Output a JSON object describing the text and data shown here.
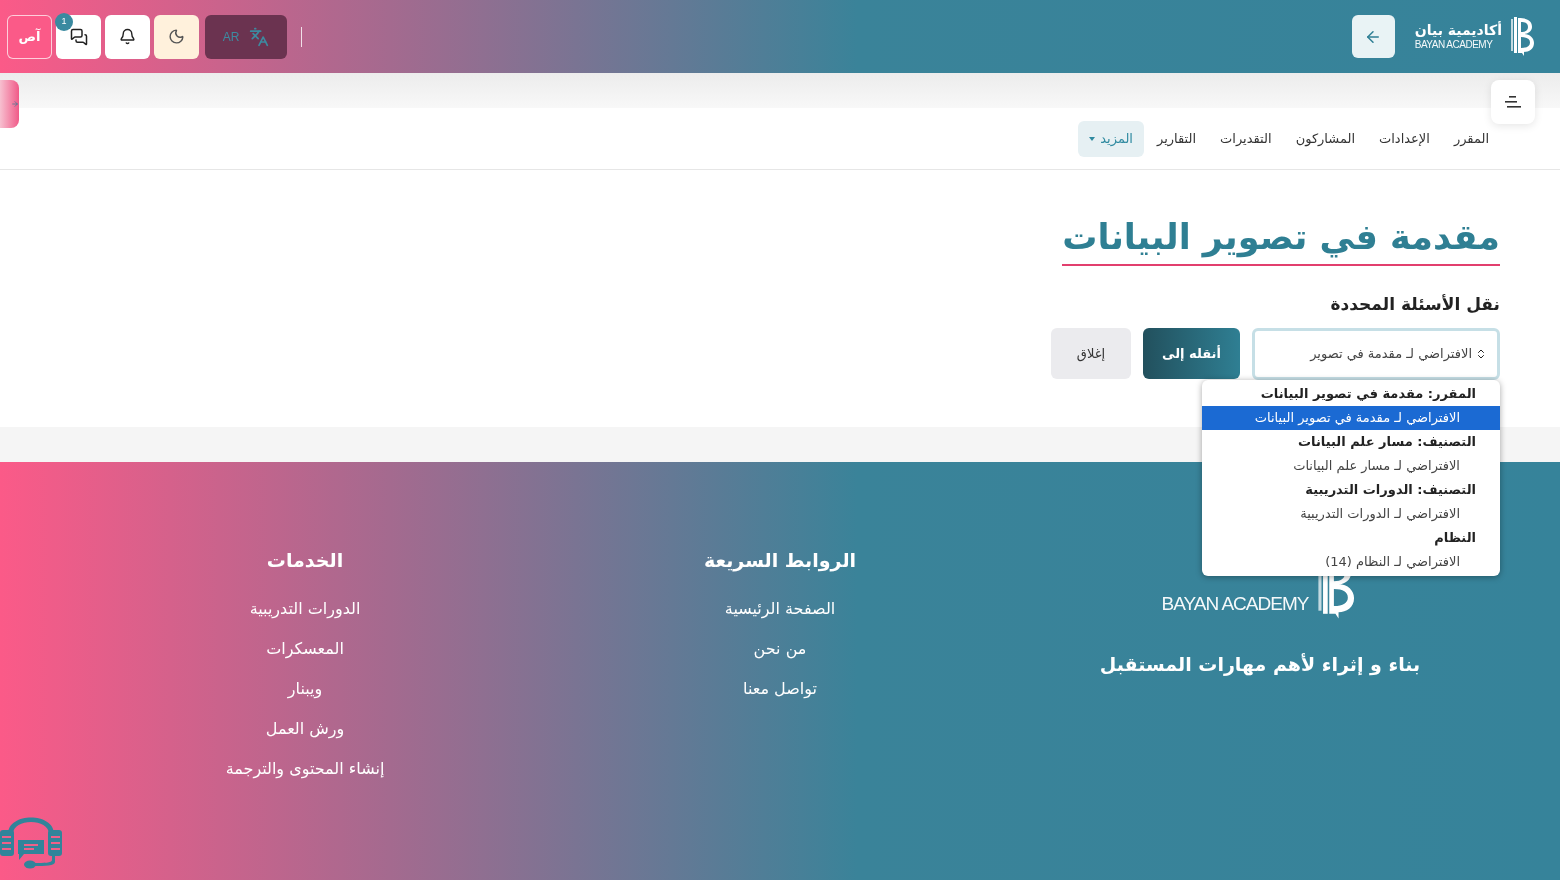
{
  "header": {
    "brand": {
      "arabic": "أكاديمية بيان",
      "latin": "BAYAN ACADEMY"
    },
    "language": "AR",
    "messages_badge": "1",
    "avatar": "آص"
  },
  "nav": [
    {
      "label": "المقرر",
      "selected": false
    },
    {
      "label": "الإعدادات",
      "selected": false
    },
    {
      "label": "المشاركون",
      "selected": false
    },
    {
      "label": "التقديرات",
      "selected": false
    },
    {
      "label": "التقارير",
      "selected": false
    },
    {
      "label": "المزيد",
      "selected": true
    }
  ],
  "page": {
    "title": "مقدمة في تصوير البيانات",
    "subtitle": "نقل الأسئلة المحددة",
    "select": {
      "value": "الافتراضي لـ مقدمة في تصوير",
      "expanded": true
    },
    "buttons": [
      {
        "label": "أنقله إلى",
        "kind": "primary"
      },
      {
        "label": "إغلاق",
        "kind": "secondary"
      }
    ]
  },
  "dropdown": {
    "groups": [
      {
        "label": "المقرر: مقدمة في تصوير البيانات",
        "options": [
          {
            "label": "الافتراضي لـ مقدمة في تصوير البيانات",
            "selected": true
          }
        ]
      },
      {
        "label": "التصنيف: مسار علم البيانات",
        "options": [
          {
            "label": "الافتراضي لـ مسار علم البيانات",
            "selected": false
          }
        ]
      },
      {
        "label": "التصنيف: الدورات التدريبية",
        "options": [
          {
            "label": "الافتراضي لـ الدورات التدريبية",
            "selected": false
          }
        ]
      },
      {
        "label": "النظام",
        "options": [
          {
            "label": "الافتراضي لـ النظام (14)",
            "selected": false
          }
        ]
      }
    ]
  },
  "footer": {
    "brand": {
      "latin": "BAYAN ACADEMY"
    },
    "slogan": "بناء و إثراء لأهم مهارات المستقبل",
    "columns": [
      {
        "title": "الروابط السريعة",
        "links": [
          "الصفحة الرئيسية",
          "من نحن",
          "تواصل معنا"
        ]
      },
      {
        "title": "الخدمات",
        "links": [
          "الدورات التدريبية",
          "المعسكرات",
          "ويبنار",
          "ورش العمل",
          "إنشاء المحتوى والترجمة"
        ]
      }
    ]
  }
}
